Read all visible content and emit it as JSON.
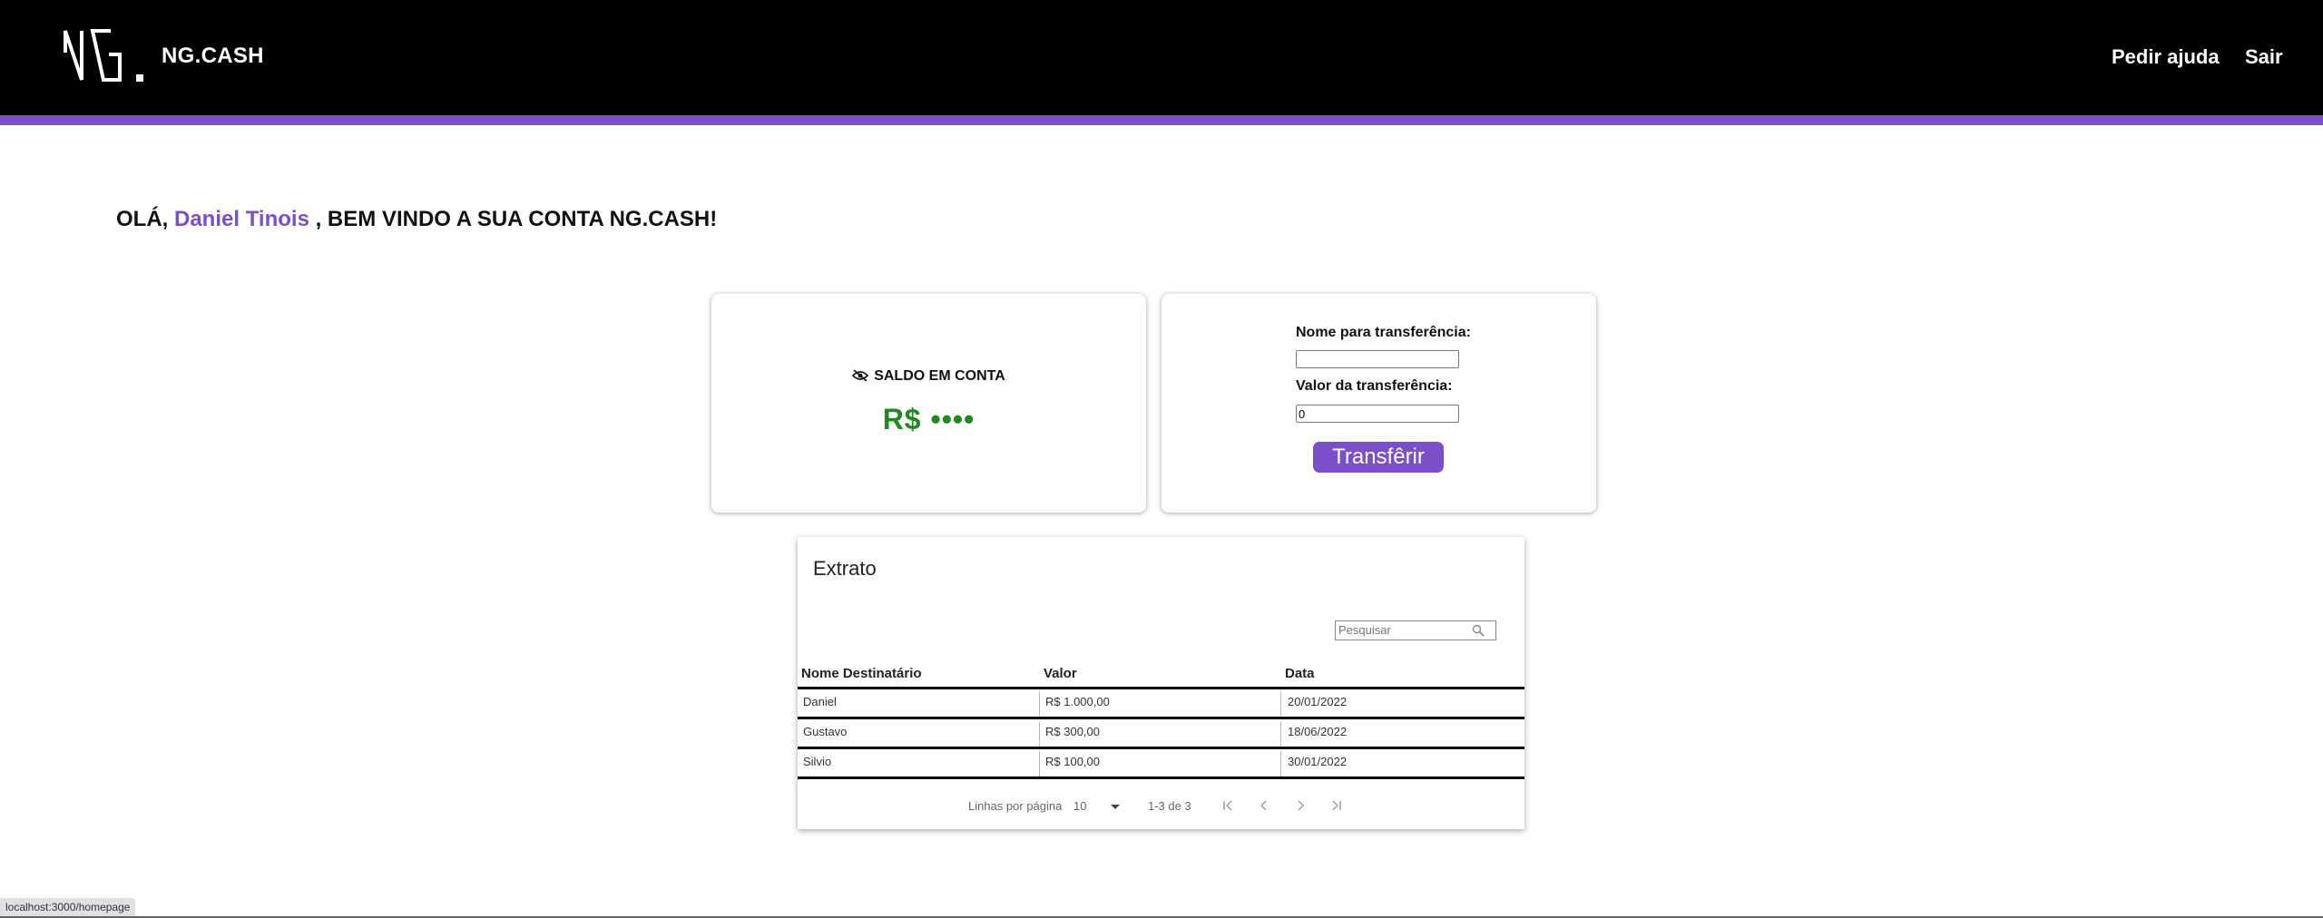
{
  "header": {
    "brand": "NG.CASH",
    "nav": {
      "help": "Pedir ajuda",
      "exit": "Sair"
    },
    "accent_color": "#7b4fc9"
  },
  "greeting": {
    "prefix": "OLÁ,",
    "name": "Daniel Tinois",
    "suffix": ", BEM VINDO A SUA CONTA NG.CASH!"
  },
  "balance": {
    "label": "SALDO EM CONTA",
    "value": "R$ ••••",
    "icon": "eye-slash-icon",
    "value_color": "#1f8a1f"
  },
  "transfer": {
    "name_label": "Nome para transferência:",
    "name_value": "",
    "amount_label": "Valor da transferência:",
    "amount_value": "0",
    "button_label": "Transfêrir"
  },
  "extract": {
    "title": "Extrato",
    "search_placeholder": "Pesquisar",
    "columns": [
      "Nome Destinatário",
      "Valor",
      "Data"
    ],
    "rows": [
      {
        "name": "Daniel",
        "value": "R$ 1.000,00",
        "date": "20/01/2022"
      },
      {
        "name": "Gustavo",
        "value": "R$ 300,00",
        "date": "18/06/2022"
      },
      {
        "name": "Silvio",
        "value": "R$ 100,00",
        "date": "30/01/2022"
      }
    ],
    "pagination": {
      "rows_label": "Linhas por página",
      "rows_per_page": "10",
      "range": "1-3 de 3"
    }
  },
  "status_bar": {
    "url": "localhost:3000/homepage"
  }
}
